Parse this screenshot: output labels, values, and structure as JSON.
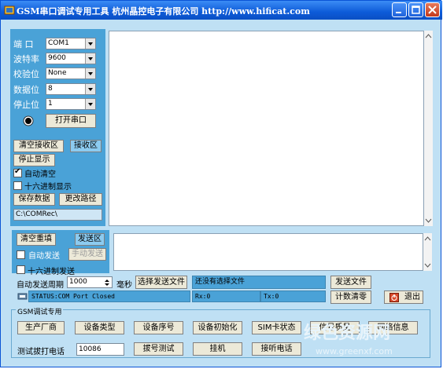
{
  "window": {
    "title": "GSM串口调试专用工具  杭州晶控电子有限公司   http://www.hificat.com"
  },
  "serial": {
    "port_label": "端 口",
    "port_value": "COM1",
    "baud_label": "波特率",
    "baud_value": "9600",
    "parity_label": "校验位",
    "parity_value": "None",
    "databits_label": "数据位",
    "databits_value": "8",
    "stopbits_label": "停止位",
    "stopbits_value": "1",
    "open_label": "打开串口"
  },
  "receive": {
    "clear_label": "清空接收区",
    "recv_area_label": "接收区",
    "stop_label": "停止显示",
    "autoclear_label": "自动清空",
    "autoclear_checked": true,
    "hex_label": "十六进制显示",
    "hex_checked": false,
    "save_label": "保存数据",
    "path_button_label": "更改路径",
    "path_value": "C:\\COMRec\\"
  },
  "send": {
    "clear_label": "清空重填",
    "send_area_label": "发送区",
    "autosend_label": "自动发送",
    "manual_label": "手动发送",
    "hex_label": "十六进制发送",
    "period_label": "自动发送周期",
    "period_value": "1000",
    "period_unit": "毫秒",
    "select_file_label": "选择发送文件",
    "file_status": "还没有选择文件",
    "send_file_label": "发送文件",
    "reset_count_label": "计数清零",
    "exit_label": "退出"
  },
  "statusbar": {
    "status": "STATUS:COM Port Closed",
    "rx": "Rx:0",
    "tx": "Tx:0"
  },
  "gsm": {
    "title": "GSM调试专用",
    "buttons": [
      "生产厂商",
      "设备类型",
      "设备序号",
      "设备初始化",
      "SIM卡状态",
      "信号质量",
      "网络信息"
    ],
    "dial_label": "测试拔打电话",
    "dial_value": "10086",
    "dial_test_label": "拔号测试",
    "hangup_label": "挂机",
    "answer_label": "接听电话"
  },
  "watermark": {
    "text": "绿色资源网",
    "url": "www.greenxf.com"
  },
  "colors": {
    "panel": "#4aa2d7",
    "window": "#bfe0f4",
    "titlebar": "#0d5bd8"
  }
}
